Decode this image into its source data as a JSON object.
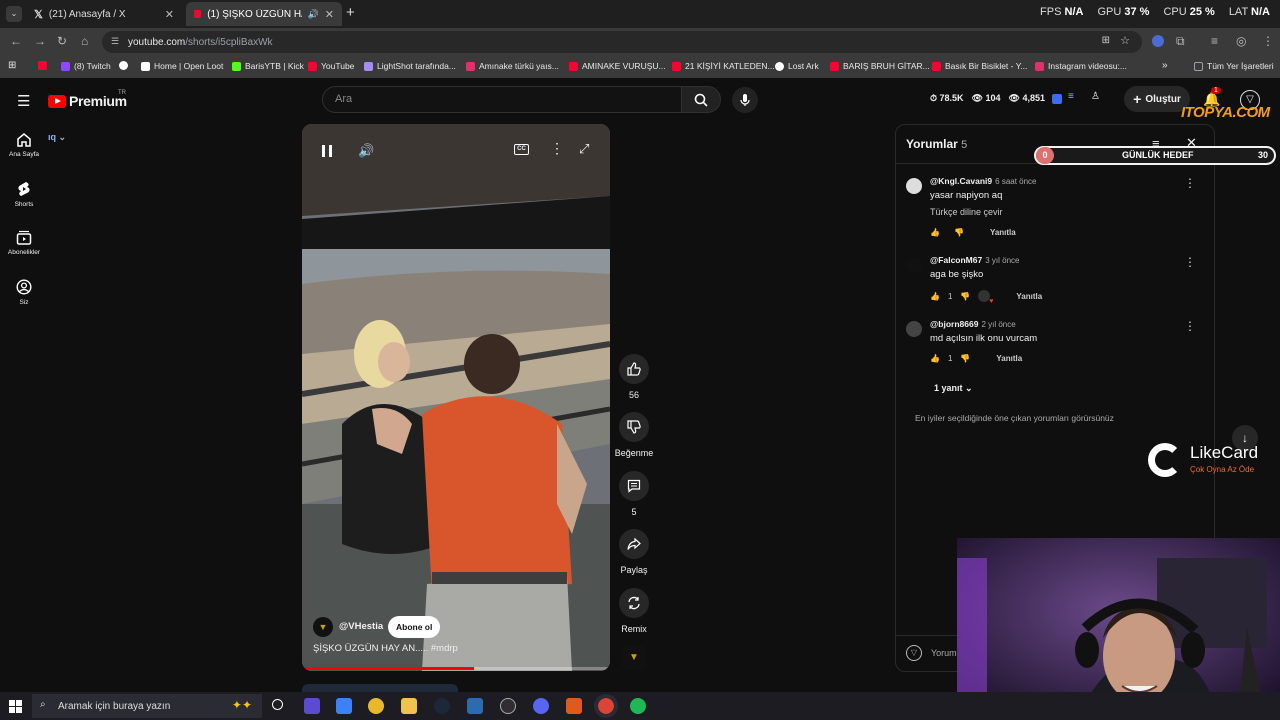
{
  "tabs": [
    {
      "title": "(21) Anasayfa / X",
      "active": false
    },
    {
      "title": "(1) ŞİŞKO ÜZGÜN HAY AN...",
      "active": true
    }
  ],
  "hud": {
    "fps_label": "FPS",
    "fps_value": "N/A",
    "gpu_label": "GPU",
    "gpu_value": "37 %",
    "cpu_label": "CPU",
    "cpu_value": "25 %",
    "lat_label": "LAT",
    "lat_value": "N/A"
  },
  "address": {
    "host": "youtube.com",
    "path": "/shorts/i5cpliBaxWk"
  },
  "bookmarks": [
    {
      "label": "",
      "color": "#ff0033"
    },
    {
      "label": "(8) Twitch",
      "color": "#9146ff"
    },
    {
      "label": "",
      "color": "#ffffff"
    },
    {
      "label": "Home | Open Loot",
      "color": "#ffffff"
    },
    {
      "label": "BarisYTB | Kick",
      "color": "#53fc18"
    },
    {
      "label": "YouTube",
      "color": "#ff0033"
    },
    {
      "label": "LightShot tarafında...",
      "color": "#a78bfa"
    },
    {
      "label": "Amınake türkü yaıs...",
      "color": "#e1306c"
    },
    {
      "label": "AMINAKE VURUŞU...",
      "color": "#ff0033"
    },
    {
      "label": "21 KİŞİYİ KATLEDEN...",
      "color": "#ff0033"
    },
    {
      "label": "Lost Ark",
      "color": "#ffffff"
    },
    {
      "label": "BARIŞ BRUH GİTAR...",
      "color": "#ff0033"
    },
    {
      "label": "Basık Bir Bisiklet - Y...",
      "color": "#ff0033"
    },
    {
      "label": "Instagram videosu:...",
      "color": "#e1306c"
    },
    {
      "label": "Tüm Yer İşaretleri",
      "color": "#9aa0a6"
    }
  ],
  "yt": {
    "brand": "Premium",
    "region": "TR",
    "search_placeholder": "Ara",
    "create_label": "Oluştur",
    "notif_count": "1",
    "stats": {
      "views": "78.5K",
      "eye": "104",
      "viewers": "4,851"
    },
    "nav": [
      {
        "label": "Ana Sayfa",
        "icon": "home-icon"
      },
      {
        "label": "Shorts",
        "icon": "shorts-icon"
      },
      {
        "label": "Abonelikler",
        "icon": "subscriptions-icon"
      },
      {
        "label": "Siz",
        "icon": "you-icon"
      }
    ],
    "video": {
      "channel": "@VHestia",
      "subscribe_label": "Abone ol",
      "title": "ŞİŞKO ÜZGÜN HAY AN..... #mdrp",
      "progress": 0.56
    },
    "actions": [
      {
        "label": "56",
        "icon": "like-icon"
      },
      {
        "label": "Beğenme",
        "icon": "dislike-icon"
      },
      {
        "label": "5",
        "icon": "comment-icon"
      },
      {
        "label": "Paylaş",
        "icon": "share-icon"
      },
      {
        "label": "Remix",
        "icon": "remix-icon"
      }
    ],
    "comments": {
      "title": "Yorumlar",
      "count": "5",
      "items": [
        {
          "user": "@Kngl.Cavani9",
          "time": "6 saat önce",
          "text": "yasar napiyon aq",
          "sub": "Türkçe diline çevir",
          "likes": "",
          "reply": "Yanıtla"
        },
        {
          "user": "@FalconM67",
          "time": "3 yıl önce",
          "text": "aga be şişko",
          "sub": "",
          "likes": "1",
          "reply": "Yanıtla"
        },
        {
          "user": "@bjorn8669",
          "time": "2 yıl önce",
          "text": "md açılsın ilk onu vurcam",
          "sub": "",
          "likes": "1",
          "reply": "Yanıtla"
        }
      ],
      "replies_toggle": "1 yanıt",
      "footer_note": "En iyiler seçildiğinde öne çıkan yorumları görürsünüz",
      "input_placeholder": "Yorum"
    }
  },
  "overlays": {
    "brand_tag": "ITOPYA.COM",
    "goal": {
      "current": "0",
      "label": "GÜNLÜK HEDEF",
      "target": "30"
    },
    "sponsor": {
      "name": "LikeCard",
      "tagline": "Çok Oyna Az Öde"
    }
  },
  "taskbar": {
    "search_placeholder": "Aramak için buraya yazın"
  }
}
